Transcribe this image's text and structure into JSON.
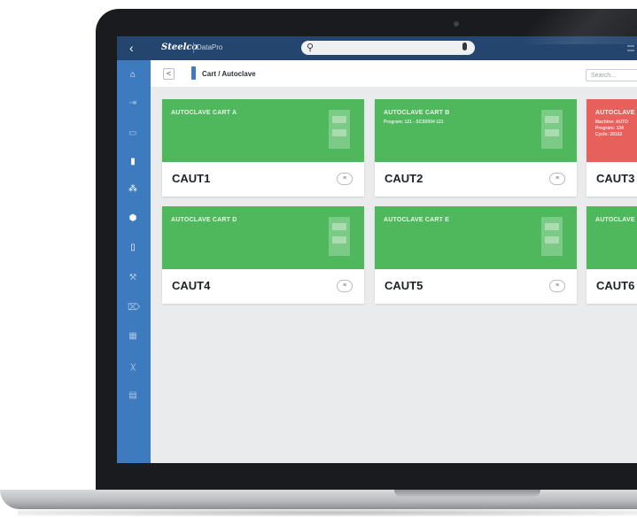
{
  "app": {
    "brand": "Steelco",
    "product": "DataPro",
    "back_glyph": "‹"
  },
  "search_top": {
    "icon": "search-icon",
    "mic": "microphone-icon"
  },
  "sidebar": {
    "items": [
      {
        "icon": "home-icon",
        "glyph": "⌂"
      },
      {
        "icon": "login-icon",
        "glyph": "⇥"
      },
      {
        "icon": "folder-icon",
        "glyph": "▭"
      },
      {
        "icon": "cart-icon",
        "glyph": "▮"
      },
      {
        "icon": "drops-icon",
        "glyph": "⁂"
      },
      {
        "icon": "package-icon",
        "glyph": "⬢"
      },
      {
        "icon": "document-icon",
        "glyph": "▯"
      },
      {
        "icon": "tools-icon",
        "glyph": "⚒"
      },
      {
        "icon": "tag-icon",
        "glyph": "⌦"
      },
      {
        "icon": "calendar-icon",
        "glyph": "▦"
      },
      {
        "icon": "users-icon",
        "glyph": "ꭓ"
      },
      {
        "icon": "report-icon",
        "glyph": "▤"
      }
    ]
  },
  "header": {
    "back_glyph": "<",
    "breadcrumb": "Cart / Autoclave",
    "search_placeholder": "Search..."
  },
  "cards": [
    {
      "title": "AUTOCLAVE CART A",
      "code": "CAUT1",
      "status": "green",
      "lines": []
    },
    {
      "title": "AUTOCLAVE CART B",
      "code": "CAUT2",
      "status": "green",
      "lines": [
        "Program: 121 - SCS0004 121"
      ]
    },
    {
      "title": "AUTOCLAVE",
      "code": "CAUT3",
      "status": "red",
      "lines": [
        "Machine: AUTO",
        "Program: 134",
        "Cycle: 28152"
      ]
    },
    {
      "title": "AUTOCLAVE CART D",
      "code": "CAUT4",
      "status": "green",
      "lines": []
    },
    {
      "title": "AUTOCLAVE CART E",
      "code": "CAUT5",
      "status": "green",
      "lines": []
    },
    {
      "title": "AUTOCLAVE",
      "code": "CAUT6",
      "status": "green",
      "lines": []
    }
  ],
  "colors": {
    "topbar": "#23456e",
    "sidebar": "#3d7bbe",
    "card_ok": "#4fb85c",
    "card_alert": "#e8605c",
    "background": "#e9ebec"
  }
}
